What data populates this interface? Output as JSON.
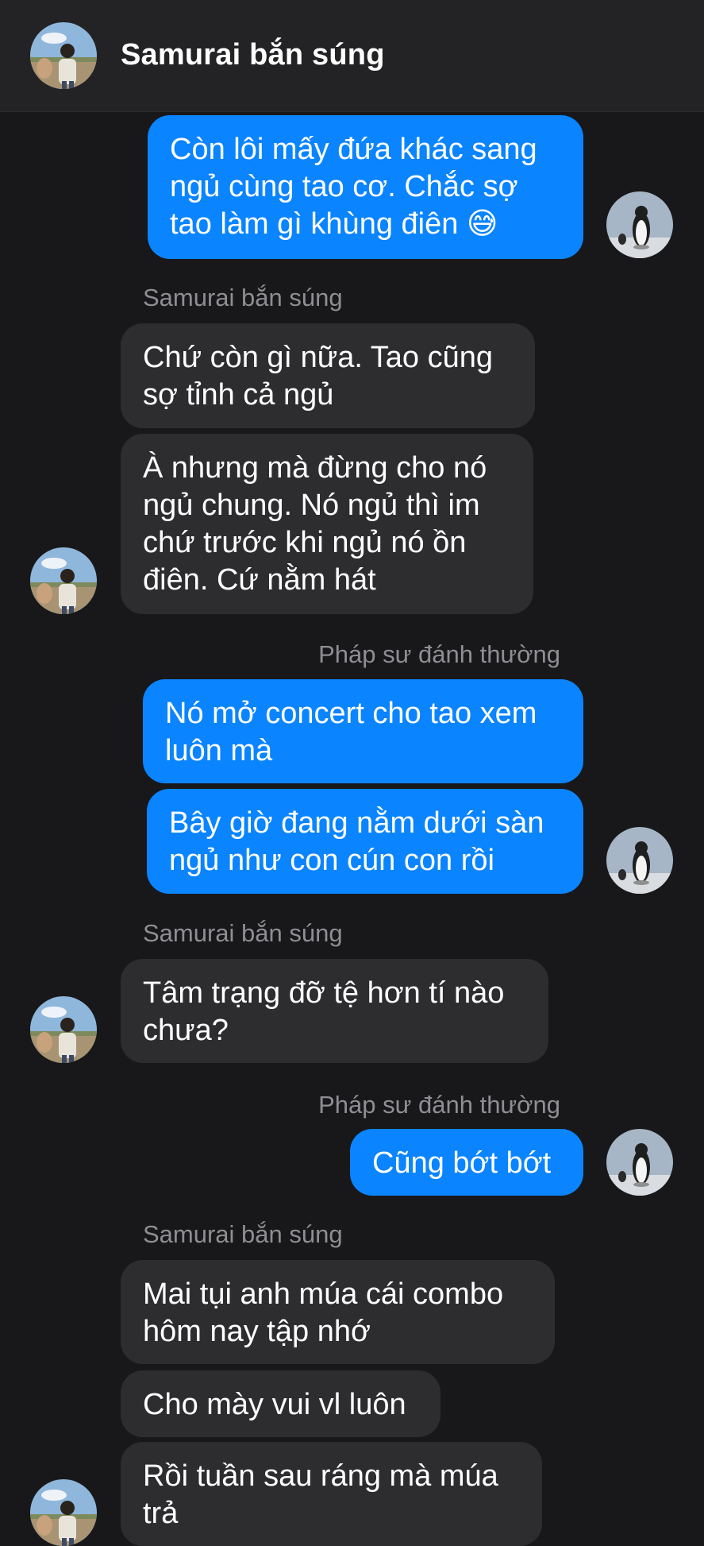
{
  "header": {
    "title": "Samurai bắn súng"
  },
  "icons": {
    "contact_avatar": "avatar-photo-person-field",
    "self_avatar": "avatar-photo-penguin"
  },
  "colors": {
    "background": "#18181a",
    "header_background": "#232325",
    "incoming_bubble": "#2d2d30",
    "outgoing_bubble": "#0a84ff",
    "sender_label": "#8e8e93"
  },
  "messages": [
    {
      "id": 0,
      "direction": "out",
      "text": "Còn lôi mấy đứa khác sang\nngủ cùng tao cơ. Chắc sợ\ntao làm gì khùng điên 😅"
    },
    {
      "id": 1,
      "direction": "in",
      "sender": "Samurai bắn súng",
      "text": "Chứ còn gì nữa. Tao cũng\nsợ tỉnh cả ngủ"
    },
    {
      "id": 2,
      "direction": "in",
      "text": "À nhưng mà đừng cho nó\nngủ chung. Nó ngủ thì im\nchứ trước khi ngủ nó ồn\nđiên. Cứ nằm hát"
    },
    {
      "id": 3,
      "direction": "out",
      "sender": "Pháp sư đánh thường",
      "text": "Nó mở concert cho tao xem\nluôn mà"
    },
    {
      "id": 4,
      "direction": "out",
      "text": "Bây giờ đang nằm dưới sàn\nngủ như con cún con rồi"
    },
    {
      "id": 5,
      "direction": "in",
      "sender": "Samurai bắn súng",
      "text": "Tâm trạng đỡ tệ hơn tí nào\nchưa?"
    },
    {
      "id": 6,
      "direction": "out",
      "sender": "Pháp sư đánh thường",
      "text": "Cũng bớt bớt"
    },
    {
      "id": 7,
      "direction": "in",
      "sender": "Samurai bắn súng",
      "text": "Mai tụi anh múa cái combo\nhôm nay tập nhớ"
    },
    {
      "id": 8,
      "direction": "in",
      "text": "Cho mày vui vl luôn"
    },
    {
      "id": 9,
      "direction": "in",
      "text": "Rồi tuần sau ráng mà múa\ntrả"
    }
  ]
}
